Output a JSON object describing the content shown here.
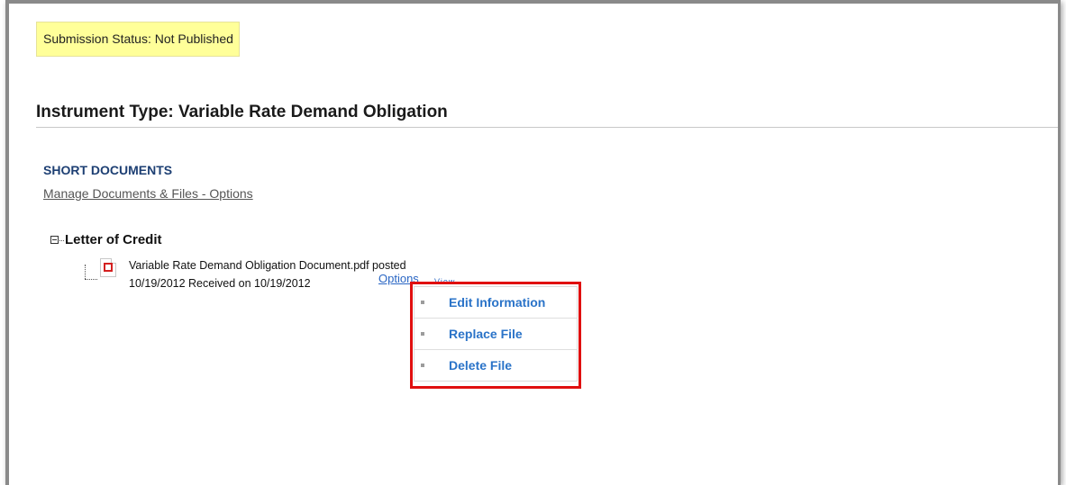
{
  "status": {
    "text": "Submission Status: Not Published"
  },
  "instrument": {
    "title": "Instrument Type: Variable Rate Demand Obligation"
  },
  "section": {
    "heading": "SHORT DOCUMENTS",
    "manage_link": "Manage Documents & Files - Options"
  },
  "tree": {
    "node_label": "Letter of Credit",
    "document": {
      "line1": "Variable Rate Demand Obligation Document.pdf posted",
      "line2": "10/19/2012 Received on 10/19/2012",
      "options_label": "Options",
      "view_partial": "View",
      "icon": "pdf-icon"
    }
  },
  "context_menu": {
    "items": [
      {
        "label": "Edit Information"
      },
      {
        "label": "Replace File"
      },
      {
        "label": "Delete File"
      }
    ]
  },
  "colors": {
    "status_bg": "#ffff99",
    "link": "#2a66c4",
    "heading_blue": "#1d3f73",
    "highlight": "#e01010"
  }
}
